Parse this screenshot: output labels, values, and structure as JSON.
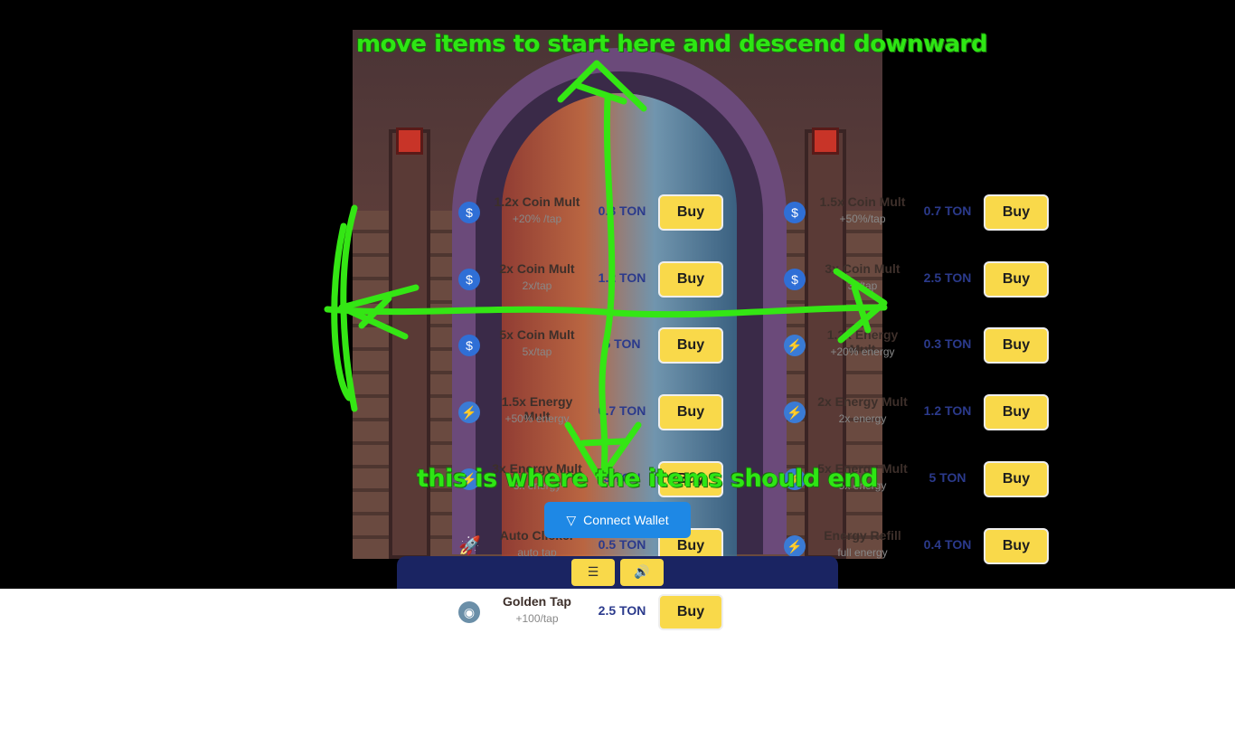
{
  "annotations": {
    "top": "move items to start here and descend downward",
    "bottom": "this is where the items should end"
  },
  "connect_wallet": {
    "label": "Connect Wallet",
    "icon": "ton-diamond-icon"
  },
  "toolbar": {
    "menu_label": "☰",
    "sound_label": "🔊"
  },
  "left_column": [
    {
      "name": "1.2x Coin Mult",
      "desc": "+20% /tap",
      "price": "0.3 TON",
      "button": "Buy",
      "icon": "coin-icon"
    },
    {
      "name": "2x Coin Mult",
      "desc": "2x/tap",
      "price": "1.2 TON",
      "button": "Buy",
      "icon": "coin-icon"
    },
    {
      "name": "5x Coin Mult",
      "desc": "5x/tap",
      "price": "5 TON",
      "button": "Buy",
      "icon": "coin-icon"
    },
    {
      "name": "1.5x Energy Mult",
      "desc": "+50% energy",
      "price": "0.7 TON",
      "button": "Buy",
      "icon": "energy-icon"
    },
    {
      "name": "3x Energy Mult",
      "desc": "3x energy",
      "price": "3 TON",
      "button": "Buy",
      "icon": "energy-icon"
    },
    {
      "name": "Auto Clicker",
      "desc": "auto tap",
      "price": "0.5 TON",
      "button": "Buy",
      "icon": "rocket-icon"
    },
    {
      "name": "Golden Tap",
      "desc": "+100/tap",
      "price": "2.5 TON",
      "button": "Buy",
      "icon": "golden-icon"
    }
  ],
  "right_column": [
    {
      "name": "1.5x Coin Mult",
      "desc": "+50%/tap",
      "price": "0.7 TON",
      "button": "Buy",
      "icon": "coin-icon"
    },
    {
      "name": "3x Coin Mult",
      "desc": "3x/tap",
      "price": "2.5 TON",
      "button": "Buy",
      "icon": "coin-icon"
    },
    {
      "name": "1.2x Energy Mult",
      "desc": "+20% energy",
      "price": "0.3 TON",
      "button": "Buy",
      "icon": "energy-icon"
    },
    {
      "name": "2x Energy Mult",
      "desc": "2x energy",
      "price": "1.2 TON",
      "button": "Buy",
      "icon": "energy-icon"
    },
    {
      "name": "5x Energy Mult",
      "desc": "5x energy",
      "price": "5 TON",
      "button": "Buy",
      "icon": "energy-icon"
    },
    {
      "name": "Energy Refill",
      "desc": "full energy",
      "price": "0.4 TON",
      "button": "Buy",
      "icon": "energy-icon"
    }
  ]
}
